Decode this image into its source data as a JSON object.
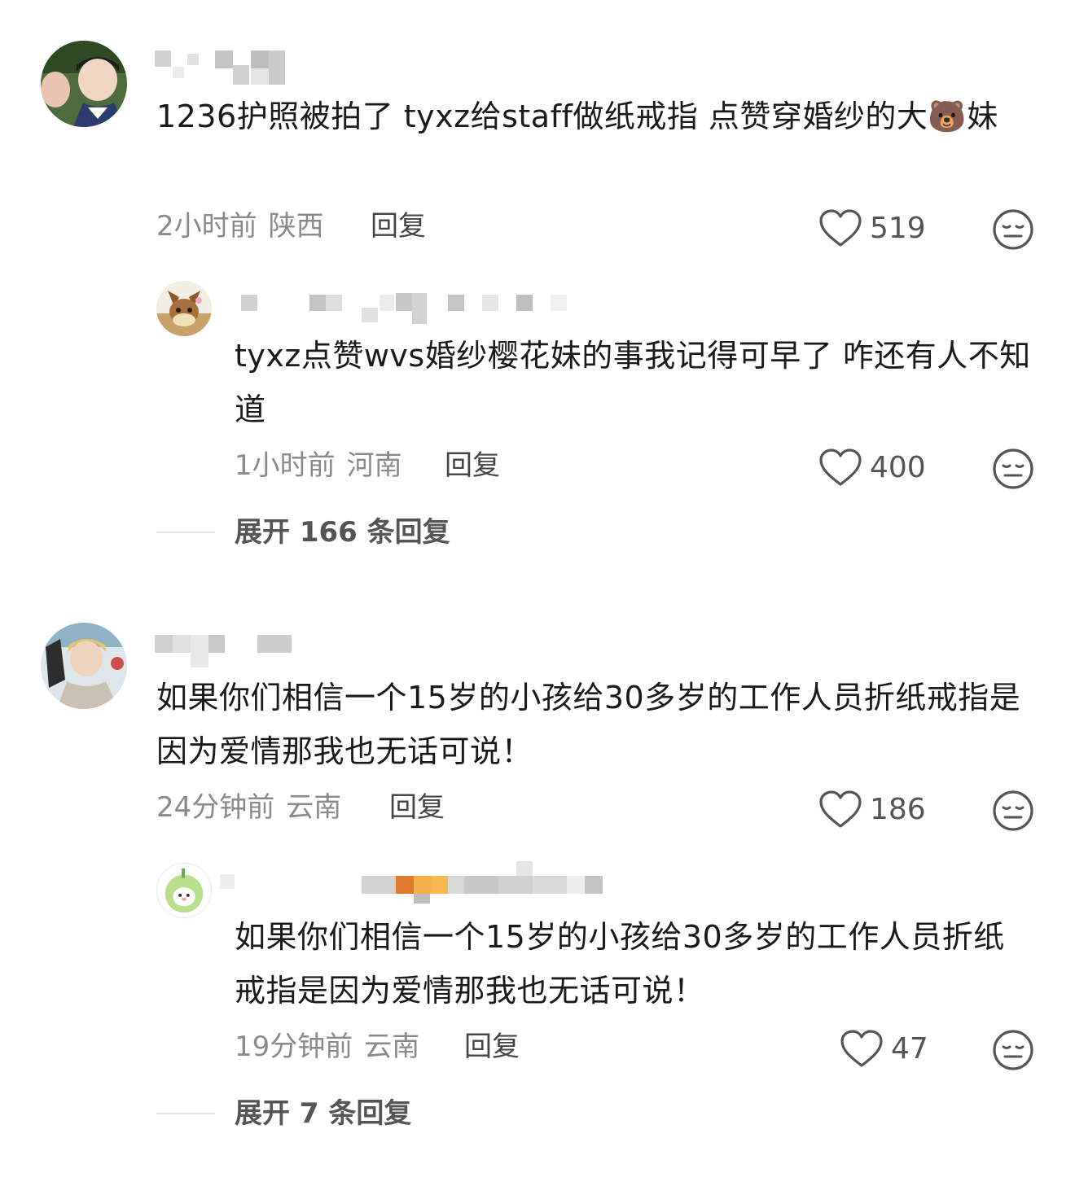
{
  "colors": {
    "text": "#1a1a1a",
    "meta": "#8a8a8a",
    "icon": "#555555"
  },
  "comments": [
    {
      "text": "1236护照被拍了 tyxz给staff做纸戒指 点赞穿婚纱的大🐻妹",
      "time": "2小时前",
      "location": "陕西",
      "reply_label": "回复",
      "likes": "519",
      "avatar_icon": "user-photo",
      "replies": [
        {
          "text": "tyxz点赞wvs婚纱樱花妹的事我记得可早了 咋还有人不知道",
          "time": "1小时前",
          "location": "河南",
          "reply_label": "回复",
          "likes": "400",
          "avatar_icon": "cartoon-fox"
        }
      ],
      "expand_label": "展开 166 条回复"
    },
    {
      "text": "如果你们相信一个15岁的小孩给30多岁的工作人员折纸戒指是因为爱情那我也无话可说！",
      "time": "24分钟前",
      "location": "云南",
      "reply_label": "回复",
      "likes": "186",
      "avatar_icon": "user-photo",
      "replies": [
        {
          "text": "如果你们相信一个15岁的小孩给30多岁的工作人员折纸戒指是因为爱情那我也无话可说！",
          "time": "19分钟前",
          "location": "云南",
          "reply_label": "回复",
          "likes": "47",
          "avatar_icon": "cartoon-seal"
        }
      ],
      "expand_label": "展开 7 条回复"
    }
  ]
}
